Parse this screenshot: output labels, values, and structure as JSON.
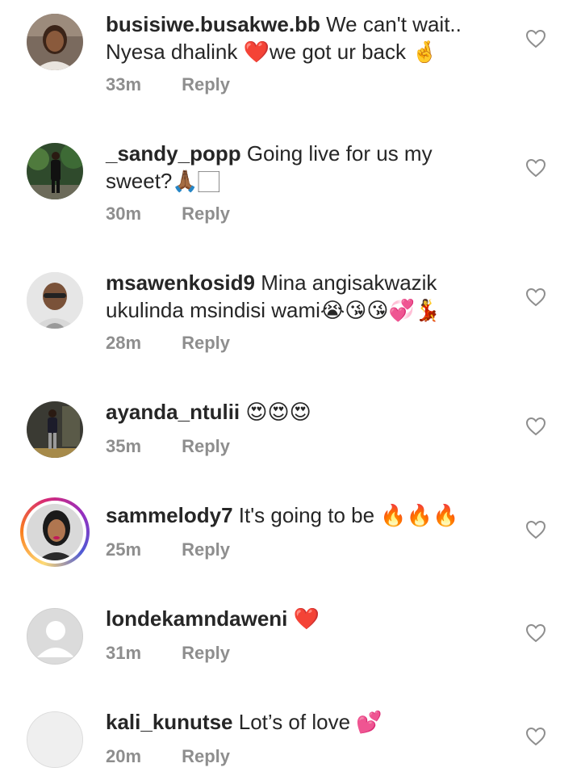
{
  "comments": [
    {
      "username": "busisiwe.busakwe.bb",
      "text": "We can't wait.. Nyesa dhalink ❤️we got ur back 🤞",
      "time": "33m",
      "reply": "Reply",
      "avatar": "photo-woman-icon"
    },
    {
      "username": "_sandy_popp",
      "text": "Going live for us my sweet?🙏🏾🏻",
      "time": "30m",
      "reply": "Reply",
      "avatar": "photo-man-suit-icon"
    },
    {
      "username": "msawenkosid9",
      "text": "Mina angisakwazik ukulinda msindisi wami😭😘😘💞💃",
      "time": "28m",
      "reply": "Reply",
      "avatar": "photo-man-sunglasses-icon"
    },
    {
      "username": "ayanda_ntulii",
      "text": "😍😍😍",
      "time": "35m",
      "reply": "Reply",
      "avatar": "photo-man-standing-icon"
    },
    {
      "username": "sammelody7",
      "text": "It's going to be 🔥🔥🔥",
      "time": "25m",
      "reply": "Reply",
      "avatar": "photo-woman-story-icon"
    },
    {
      "username": "londekamndaweni",
      "text": "❤️",
      "time": "31m",
      "reply": "Reply",
      "avatar": "default-avatar-icon"
    },
    {
      "username": "kali_kunutse",
      "text": "Lot’s of love 💕",
      "time": "20m",
      "reply": "Reply",
      "avatar": "blank-avatar-icon"
    }
  ],
  "colors": {
    "text": "#262626",
    "meta": "#8e8e8e",
    "heart_outline": "#8e8e8e"
  }
}
